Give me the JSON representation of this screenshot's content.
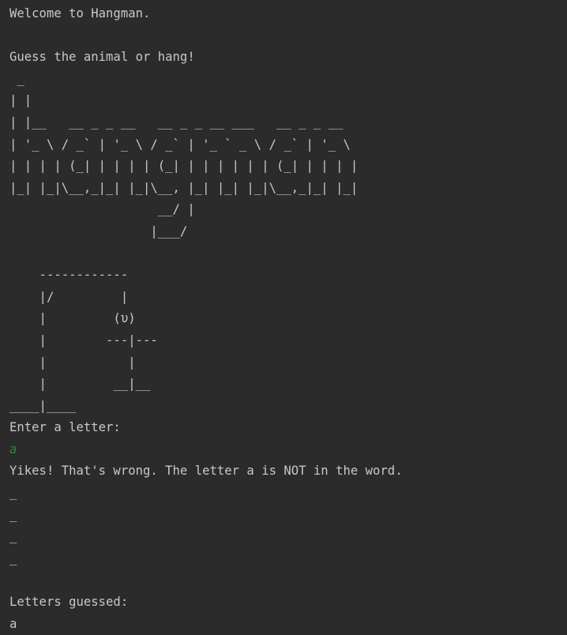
{
  "console": {
    "lines": [
      {
        "text": "Welcome to Hangman.",
        "kind": "output"
      },
      {
        "text": "",
        "kind": "output"
      },
      {
        "text": "Guess the animal or hang!",
        "kind": "output"
      },
      {
        "text": " _",
        "kind": "output"
      },
      {
        "text": "| |",
        "kind": "output"
      },
      {
        "text": "| |__   __ _ _ __   __ _ _ __ ___   __ _ _ __",
        "kind": "output"
      },
      {
        "text": "| '_ \\ / _` | '_ \\ / _` | '_ ` _ \\ / _` | '_ \\",
        "kind": "output"
      },
      {
        "text": "| | | | (_| | | | | (_| | | | | | | (_| | | | |",
        "kind": "output"
      },
      {
        "text": "|_| |_|\\__,_|_| |_|\\__, |_| |_| |_|\\__,_|_| |_|",
        "kind": "output"
      },
      {
        "text": "                    __/ |",
        "kind": "output"
      },
      {
        "text": "                   |___/",
        "kind": "output"
      },
      {
        "text": "",
        "kind": "output"
      },
      {
        "text": "    ------------",
        "kind": "output"
      },
      {
        "text": "    |/         |",
        "kind": "output"
      },
      {
        "text": "    |         (υ)",
        "kind": "output"
      },
      {
        "text": "    |        ---|---",
        "kind": "output"
      },
      {
        "text": "    |           |",
        "kind": "output"
      },
      {
        "text": "    |         __|__",
        "kind": "output"
      },
      {
        "text": "____|____",
        "kind": "output"
      },
      {
        "text": "Enter a letter:",
        "kind": "output"
      },
      {
        "text": "a",
        "kind": "input"
      },
      {
        "text": "Yikes! That's wrong. The letter a is NOT in the word.",
        "kind": "output"
      },
      {
        "text": "_",
        "kind": "output"
      },
      {
        "text": "_",
        "kind": "output"
      },
      {
        "text": "_",
        "kind": "output"
      },
      {
        "text": "_",
        "kind": "output"
      },
      {
        "text": "",
        "kind": "output"
      },
      {
        "text": "Letters guessed:",
        "kind": "output"
      },
      {
        "text": "a",
        "kind": "output"
      }
    ]
  },
  "colors": {
    "background": "#2b2b2b",
    "text": "#c8c8c8",
    "user_input": "#2e8b2e"
  }
}
